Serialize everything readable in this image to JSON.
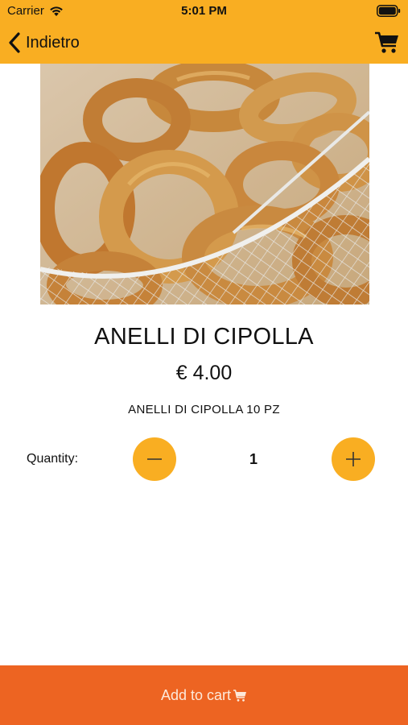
{
  "status_bar": {
    "carrier": "Carrier",
    "time": "5:01 PM"
  },
  "nav": {
    "back_label": "Indietro"
  },
  "product": {
    "title": "ANELLI DI CIPOLLA",
    "price": "€ 4.00",
    "description": "ANELLI DI CIPOLLA 10 PZ"
  },
  "quantity": {
    "label": "Quantity:",
    "value": "1"
  },
  "cart_button": {
    "label": "Add to cart"
  },
  "colors": {
    "header": "#f9ae22",
    "accent": "#f9ae22",
    "cart_bar": "#ed6422"
  }
}
